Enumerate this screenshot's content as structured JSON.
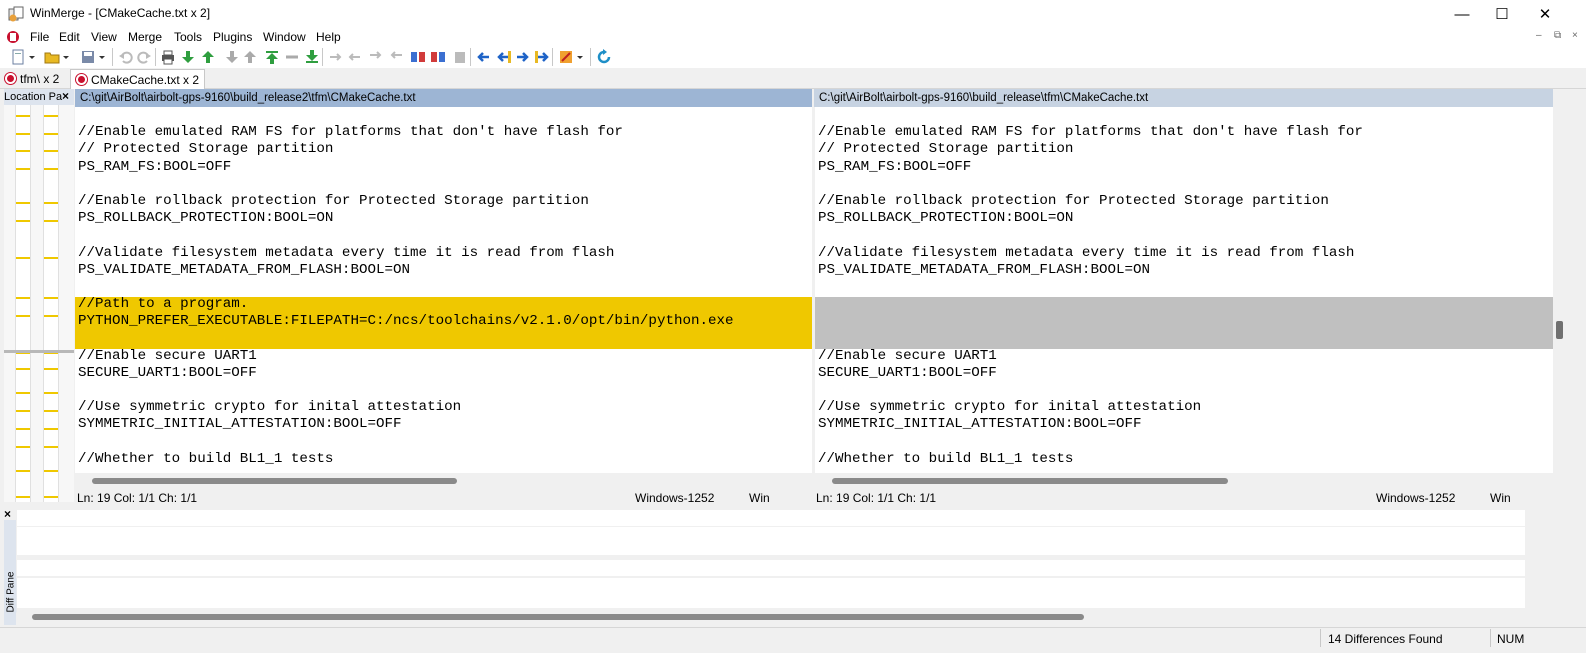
{
  "window": {
    "title": "WinMerge - [CMakeCache.txt x 2]",
    "minimize_glyph": "—",
    "maximize_glyph": "☐",
    "close_glyph": "✕"
  },
  "menu": {
    "items": [
      {
        "label": "File"
      },
      {
        "label": "Edit"
      },
      {
        "label": "View"
      },
      {
        "label": "Merge"
      },
      {
        "label": "Tools"
      },
      {
        "label": "Plugins"
      },
      {
        "label": "Window"
      },
      {
        "label": "Help"
      }
    ],
    "mdi_minimize": "‒",
    "mdi_restore": "⧉",
    "mdi_close": "×"
  },
  "tabs": [
    {
      "label": "tfm\\ x 2"
    },
    {
      "label": "CMakeCache.txt x 2"
    }
  ],
  "location_pane": {
    "title": "Location Pa",
    "close": "×"
  },
  "left_pane": {
    "path": "C:\\git\\AirBolt\\airbolt-gps-9160\\build_release2\\tfm\\CMakeCache.txt",
    "lines": [
      "",
      "//Enable emulated RAM FS for platforms that don't have flash for",
      "// Protected Storage partition",
      "PS_RAM_FS:BOOL=OFF",
      "",
      "//Enable rollback protection for Protected Storage partition",
      "PS_ROLLBACK_PROTECTION:BOOL=ON",
      "",
      "//Validate filesystem metadata every time it is read from flash",
      "PS_VALIDATE_METADATA_FROM_FLASH:BOOL=ON",
      "",
      "//Path to a program.",
      "PYTHON_PREFER_EXECUTABLE:FILEPATH=C:/ncs/toolchains/v2.1.0/opt/bin/python.exe",
      "",
      "//Enable secure UART1",
      "SECURE_UART1:BOOL=OFF",
      "",
      "//Use symmetric crypto for inital attestation",
      "SYMMETRIC_INITIAL_ATTESTATION:BOOL=OFF",
      "",
      "//Whether to build BL1_1 tests"
    ],
    "status": {
      "position": "Ln: 19  Col: 1/1  Ch: 1/1",
      "encoding": "Windows-1252",
      "eol": "Win"
    }
  },
  "right_pane": {
    "path": "C:\\git\\AirBolt\\airbolt-gps-9160\\build_release\\tfm\\CMakeCache.txt",
    "lines": [
      "",
      "//Enable emulated RAM FS for platforms that don't have flash for",
      "// Protected Storage partition",
      "PS_RAM_FS:BOOL=OFF",
      "",
      "//Enable rollback protection for Protected Storage partition",
      "PS_ROLLBACK_PROTECTION:BOOL=ON",
      "",
      "//Validate filesystem metadata every time it is read from flash",
      "PS_VALIDATE_METADATA_FROM_FLASH:BOOL=ON",
      "",
      "",
      "",
      "",
      "//Enable secure UART1",
      "SECURE_UART1:BOOL=OFF",
      "",
      "//Use symmetric crypto for inital attestation",
      "SYMMETRIC_INITIAL_ATTESTATION:BOOL=OFF",
      "",
      "//Whether to build BL1_1 tests"
    ],
    "status": {
      "position": "Ln: 19  Col: 1/1  Ch: 1/1",
      "encoding": "Windows-1252",
      "eol": "Win"
    }
  },
  "diff_pane": {
    "title": "Diff Pane",
    "close": "×"
  },
  "statusbar": {
    "differences": "14 Differences Found",
    "num": "NUM"
  },
  "colors": {
    "diff_highlight_left": "#efc800",
    "diff_highlight_right": "#c0c0c0",
    "left_path_header": "#9db5d4",
    "right_path_header": "#c7d3e2"
  }
}
